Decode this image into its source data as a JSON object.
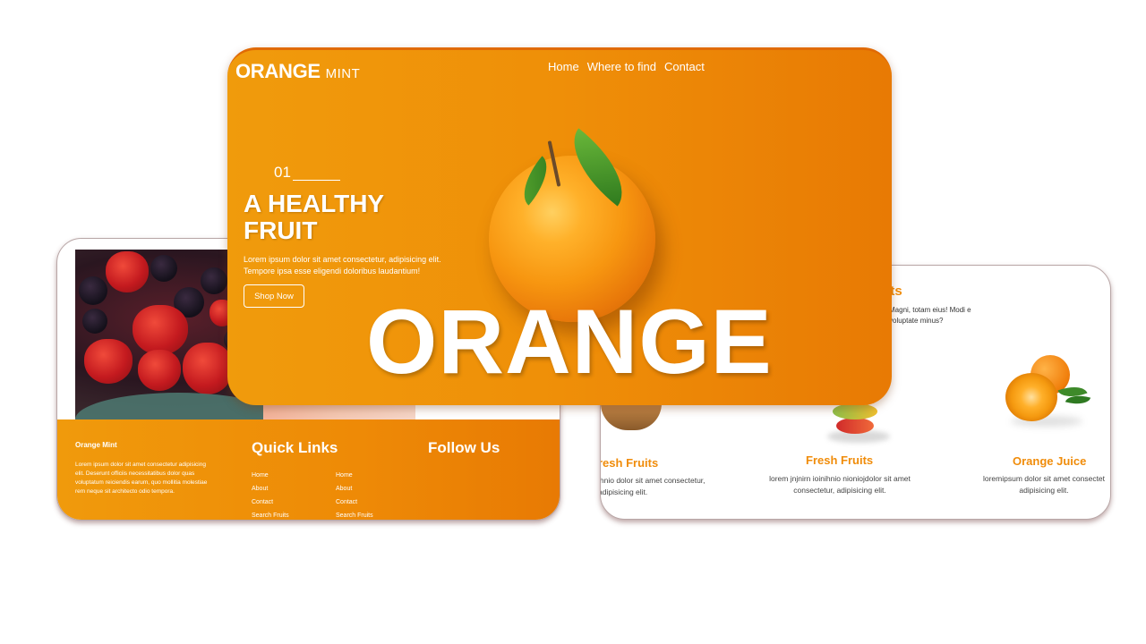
{
  "hero": {
    "logo_main": "ORANGE",
    "logo_sub": "MINT",
    "nav": [
      "Home",
      "Where to find",
      "Contact"
    ],
    "slide_number": "01",
    "title": "A HEALTHY FRUIT",
    "text": "Lorem ipsum dolor sit amet consectetur, adipisicing elit. Tempore ipsa esse eligendi doloribus laudantium!",
    "button": "Shop Now",
    "big_word": "ORANGE"
  },
  "footer": {
    "brand": "Orange Mint",
    "description": "Lorem ipsum dolor sit amet consectetur adipisicing elit. Deserunt officiis necessitatibus dolor quas voluptatum reiciendis earum, quo mollitia molestiae rem neque sit architecto odio tempora.",
    "quick_links_heading": "Quick Links",
    "follow_heading": "Follow Us",
    "links_col1": [
      "Home",
      "About",
      "Contact",
      "Search Fruits"
    ],
    "links_col2": [
      "Home",
      "About",
      "Contact",
      "Search Fruits"
    ]
  },
  "products": {
    "heading_fragment": "uits",
    "intro_fragment": "Magni, totam eius! Modi e voluptate minus?",
    "items": [
      {
        "name": "resh Fruits",
        "desc": "ihnio dolor sit amet consectetur, adipisicing elit."
      },
      {
        "name": "Fresh Fruits",
        "desc": "lorem jnjnirn ioinihnio nioniojdolor sit amet consectetur, adipisicing elit."
      },
      {
        "name": "Orange Juice",
        "desc": "loremipsum dolor sit amet consectet adipisicing elit."
      }
    ]
  },
  "colors": {
    "accent": "#f08c0a",
    "gradient_start": "#f09b0c",
    "gradient_end": "#e87a04"
  }
}
